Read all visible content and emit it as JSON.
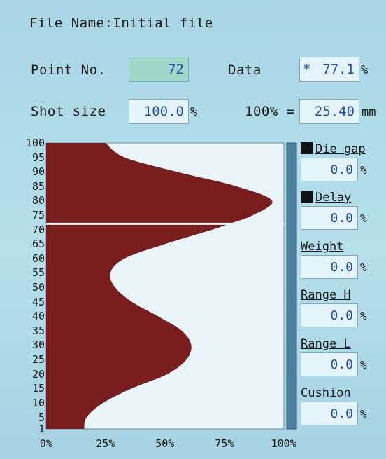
{
  "header": {
    "file_name_label": "File Name:",
    "file_name_value": "Initial file"
  },
  "point": {
    "label": "Point No.",
    "value": "72"
  },
  "data_field": {
    "label": "Data",
    "marker": "*",
    "value": "77.1",
    "unit": "%"
  },
  "shot_size": {
    "label": "Shot size",
    "value": "100.0",
    "unit": "%"
  },
  "hundred_pct": {
    "label": "100% =",
    "value": "25.40",
    "unit": "mm"
  },
  "side": {
    "die_gap": {
      "label": "Die gap",
      "value": "0.0",
      "unit": "%"
    },
    "delay": {
      "label": "Delay",
      "value": "0.0",
      "unit": "%"
    },
    "weight": {
      "label": "Weight",
      "value": "0.0",
      "unit": "%"
    },
    "range_h": {
      "label": "Range H",
      "value": "0.0",
      "unit": "%"
    },
    "range_l": {
      "label": "Range L",
      "value": "0.0",
      "unit": "%"
    },
    "cushion": {
      "label": "Cushion",
      "value": "0.0",
      "unit": "%"
    }
  },
  "chart_data": {
    "type": "area",
    "orientation": "horizontal",
    "y_ticks": [
      "100",
      "95",
      "90",
      "85",
      "80",
      "75",
      "70",
      "65",
      "60",
      "55",
      "50",
      "45",
      "40",
      "35",
      "30",
      "25",
      "20",
      "15",
      "10",
      "5",
      "1"
    ],
    "x_ticks": [
      "0%",
      "25%",
      "50%",
      "75%",
      "100%"
    ],
    "ylim": [
      1,
      100
    ],
    "xlim": [
      0,
      100
    ],
    "cursor_point": 72,
    "fill_color": "#7a1d1d",
    "points": [
      {
        "y": 1,
        "x": 16
      },
      {
        "y": 5,
        "x": 17
      },
      {
        "y": 10,
        "x": 24
      },
      {
        "y": 15,
        "x": 36
      },
      {
        "y": 20,
        "x": 51
      },
      {
        "y": 25,
        "x": 59
      },
      {
        "y": 30,
        "x": 61
      },
      {
        "y": 35,
        "x": 57
      },
      {
        "y": 40,
        "x": 47
      },
      {
        "y": 45,
        "x": 36
      },
      {
        "y": 50,
        "x": 29
      },
      {
        "y": 55,
        "x": 27
      },
      {
        "y": 60,
        "x": 33
      },
      {
        "y": 65,
        "x": 50
      },
      {
        "y": 70,
        "x": 70
      },
      {
        "y": 72,
        "x": 77
      },
      {
        "y": 75,
        "x": 87
      },
      {
        "y": 80,
        "x": 95
      },
      {
        "y": 85,
        "x": 80
      },
      {
        "y": 90,
        "x": 55
      },
      {
        "y": 95,
        "x": 33
      },
      {
        "y": 100,
        "x": 25
      }
    ]
  }
}
